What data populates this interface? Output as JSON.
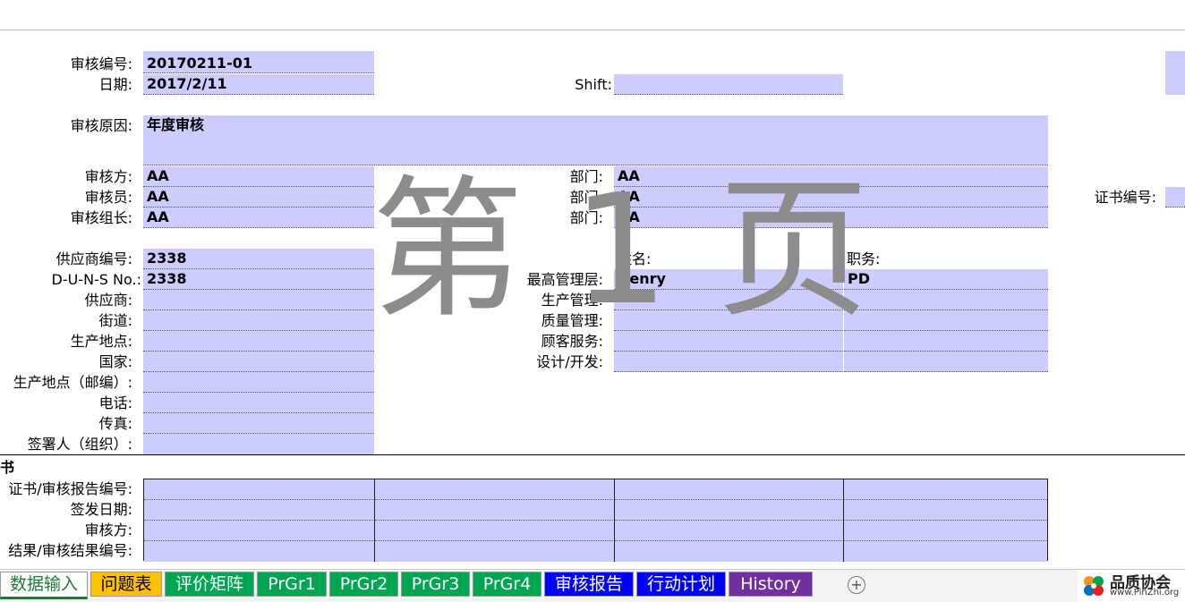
{
  "audit": {
    "number_label": "审核编号:",
    "number_value": "20170211-01",
    "date_label": "日期:",
    "date_value": "2017/2/11",
    "shift_label": "Shift:",
    "shift_value": "",
    "reason_label": "审核原因:",
    "reason_value": "年度审核",
    "party_label": "审核方:",
    "party_value": "AA",
    "auditor_label": "审核员:",
    "auditor_value": "AA",
    "leader_label": "审核组长:",
    "leader_value": "AA",
    "dept_label": "部门:",
    "dept_values": [
      "AA",
      "AA",
      "AA"
    ],
    "cert_no_label": "证书编号:"
  },
  "supplier": {
    "code_label": "供应商编号:",
    "code_value": "2338",
    "duns_label": "D-U-N-S No.:",
    "duns_value": "2338",
    "fields": [
      "供应商:",
      "街道:",
      "生产地点:",
      "国家:",
      "生产地点（邮编）:",
      "电话:",
      "传真:",
      "签署人（组织）:"
    ]
  },
  "management": {
    "name_header": "姓名:",
    "title_header": "职务:",
    "rows": [
      {
        "label": "最高管理层:",
        "name": "Henry",
        "title": "PD"
      },
      {
        "label": "生产管理:",
        "name": "",
        "title": ""
      },
      {
        "label": "质量管理:",
        "name": "",
        "title": ""
      },
      {
        "label": "顾客服务:",
        "name": "",
        "title": ""
      },
      {
        "label": "设计/开发:",
        "name": "",
        "title": ""
      }
    ]
  },
  "certificates": {
    "section_partial": "书",
    "rows": [
      "证书/审核报告编号:",
      "签发日期:",
      "审核方:",
      "结果/审核结果编号:"
    ]
  },
  "watermark": "第 1 页",
  "tabs": [
    {
      "label": "数据输入",
      "color": "#ffffff",
      "active": true
    },
    {
      "label": "问题表",
      "color": "#ffc000",
      "text": "#000000"
    },
    {
      "label": "评价矩阵",
      "color": "#00a651"
    },
    {
      "label": "PrGr1",
      "color": "#00a651"
    },
    {
      "label": "PrGr2",
      "color": "#00a651"
    },
    {
      "label": "PrGr3",
      "color": "#00a651"
    },
    {
      "label": "PrGr4",
      "color": "#00a651"
    },
    {
      "label": "审核报告",
      "color": "#0000ff"
    },
    {
      "label": "行动计划",
      "color": "#0000ff"
    },
    {
      "label": "History",
      "color": "#7030a0"
    }
  ],
  "add_sheet": "+",
  "logo": {
    "title": "品质协会",
    "url": "www.PinZhi.org"
  }
}
